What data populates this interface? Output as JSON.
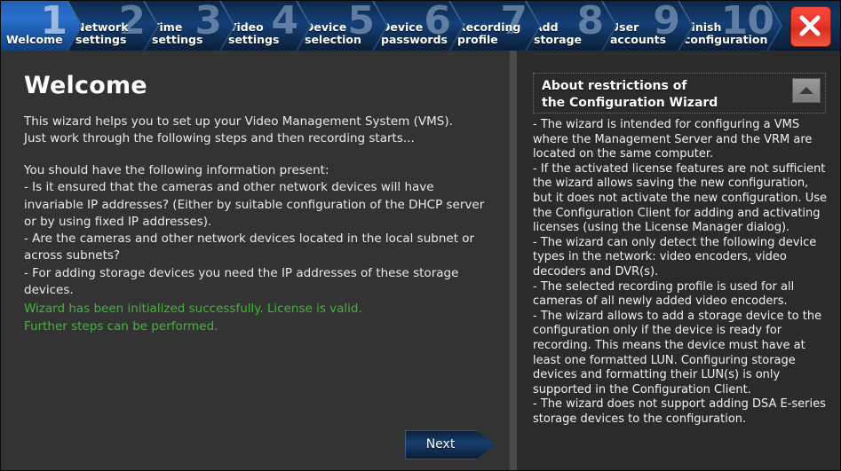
{
  "window": {
    "close_label": "×"
  },
  "wizard": {
    "steps": [
      {
        "number": "1",
        "label": "Welcome",
        "active": true
      },
      {
        "number": "2",
        "label": "Network\nsettings",
        "active": false
      },
      {
        "number": "3",
        "label": "Time\nsettings",
        "active": false
      },
      {
        "number": "4",
        "label": "Video\nsettings",
        "active": false
      },
      {
        "number": "5",
        "label": "Device\nselection",
        "active": false
      },
      {
        "number": "6",
        "label": "Device\npasswords",
        "active": false
      },
      {
        "number": "7",
        "label": "Recording\nprofile",
        "active": false
      },
      {
        "number": "8",
        "label": "Add\nstorage",
        "active": false
      },
      {
        "number": "9",
        "label": "User\naccounts",
        "active": false
      },
      {
        "number": "10",
        "label": "Finish\nconfiguration",
        "active": false
      }
    ]
  },
  "main": {
    "title": "Welcome",
    "intro": "This wizard helps you to set up your Video Management System (VMS).\nJust work through the following steps and then recording starts...",
    "requirements": "You should have the following information present:\n-  Is it ensured that the cameras and other network devices will have invariable IP addresses? (Either by suitable configuration of the DHCP server or by using fixed IP addresses).\n-  Are the cameras and other network devices located in the local subnet or across subnets?\n-  For adding storage devices you need the IP addresses of these storage devices.",
    "status": "Wizard has been initialized successfully. License is valid.\nFurther steps can be performed.",
    "status_color": "#44b33c",
    "next_label": "Next"
  },
  "help": {
    "title": "About restrictions of\nthe Configuration Wizard",
    "body": "- The wizard is intended for configuring a VMS where the Management Server and the VRM are located on the same computer.\n- If the activated license features are not sufficient the wizard allows saving the new configuration, but it does not activate the new configuration. Use the Configuration Client for adding and activating licenses  (using the License Manager dialog).\n- The wizard can only detect the following device types in the network: video encoders, video decoders and DVR(s).\n- The selected recording profile is used for all cameras of all newly added video encoders.\n- The wizard allows to add a storage device to the configuration only if the device is ready for recording. This means the device must have at least one formatted LUN. Configuring storage devices and formatting their LUN(s) is only supported in the Configuration Client.\n- The wizard does not support adding DSA E-series storage devices to the configuration."
  }
}
